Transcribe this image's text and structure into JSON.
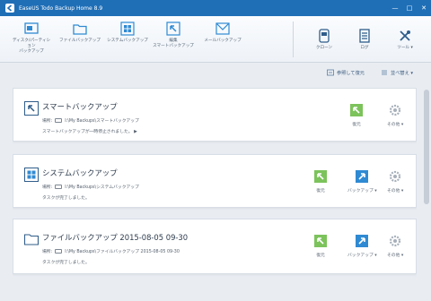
{
  "window": {
    "title": "EaseUS Todo Backup Home 8.9",
    "controls": [
      "minimize",
      "maximize",
      "close"
    ]
  },
  "toolbar": {
    "disk_partition_backup": "ディスク/パーティション\nバックアップ",
    "file_backup": "ファイルバックアップ",
    "system_backup": "システムバックアップ",
    "edit_smart_backup": "編集\nスマートバックアップ",
    "mail_backup": "メールバックアップ",
    "clone": "クローン",
    "log": "ログ",
    "tools": "ツール ▾"
  },
  "subbar": {
    "browse_restore": "参照して復元",
    "sort": "並べ替え ▾"
  },
  "tasks": [
    {
      "name": "スマートバックアップ",
      "location_label": "場所:",
      "location": "I:\\My Backups\\スマートバックアップ",
      "status": "スマートバックアップが一時停止されました。 ▶",
      "actions": [
        "復元",
        "その他 ▾"
      ]
    },
    {
      "name": "システムバックアップ",
      "location_label": "場所:",
      "location": "I:\\My Backups\\システムバックアップ",
      "status": "タスクが完了しました。",
      "actions": [
        "復元",
        "バックアップ ▾",
        "その他 ▾"
      ]
    },
    {
      "name": "ファイルバックアップ 2015-08-05 09-30",
      "location_label": "場所:",
      "location": "I:\\My Backups\\ファイルバックアップ 2015-08-05 09-30",
      "status": "タスクが完了しました。",
      "actions": [
        "復元",
        "バックアップ ▾",
        "その他 ▾"
      ]
    }
  ],
  "colors": {
    "titlebar": "#1f6fb7",
    "accent_blue": "#2f8ad3",
    "restore_green": "#7cc35b",
    "gear_gray": "#a7b0ba"
  }
}
